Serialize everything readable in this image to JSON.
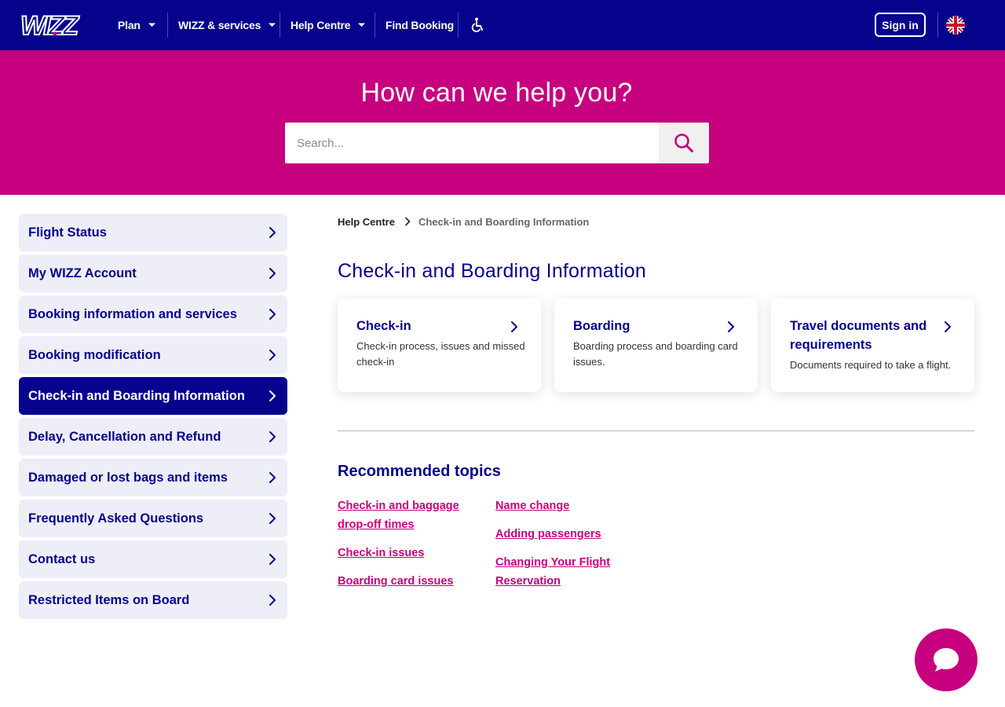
{
  "nav": {
    "items": [
      "Plan",
      "WIZZ & services",
      "Help Centre",
      "Find Booking"
    ],
    "sign_in": "Sign in"
  },
  "hero": {
    "title": "How can we help you?",
    "search_placeholder": "Search..."
  },
  "sidebar": {
    "items": [
      "Flight Status",
      "My WIZZ Account",
      "Booking information and services",
      "Booking modification",
      "Check-in and Boarding Information",
      "Delay, Cancellation and Refund",
      "Damaged or lost bags and items",
      "Frequently Asked Questions",
      "Contact us",
      "Restricted Items on Board"
    ],
    "active": "Check-in and Boarding Information"
  },
  "breadcrumb": {
    "root": "Help Centre",
    "current": "Check-in and Boarding Information"
  },
  "main": {
    "title": "Check-in and Boarding Information",
    "cards": [
      {
        "title": "Check-in",
        "desc": "Check-in process, issues and missed check-in"
      },
      {
        "title": "Boarding",
        "desc": "Boarding process and boarding card issues."
      },
      {
        "title": "Travel documents and requirements",
        "desc": "Documents required to take a flight."
      }
    ],
    "recommended_title": "Recommended topics",
    "recommended": [
      "Check-in and baggage drop-off times",
      "Check-in issues",
      "Boarding card issues",
      "Name change",
      "Adding passengers",
      "Changing Your Flight Reservation"
    ]
  },
  "colors": {
    "navy": "#06038d",
    "magenta": "#c6007e",
    "sidebar_bg": "#eeeef8"
  },
  "icons": {
    "logo": "wizz-logo",
    "accessibility": "wheelchair-icon",
    "language": "uk-flag-icon",
    "search": "search-icon",
    "chat": "chat-bubble-icon"
  }
}
